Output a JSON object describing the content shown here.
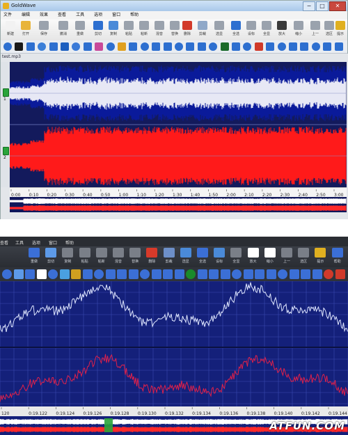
{
  "top": {
    "title": "GoldWave",
    "window_controls": [
      "−",
      "□",
      "✕"
    ],
    "menu": [
      "文件",
      "编辑",
      "效果",
      "查看",
      "工具",
      "选项",
      "窗口",
      "帮助"
    ],
    "toolbar": [
      {
        "label": "新建",
        "icon": "new-icon",
        "color": "#f2f2f2"
      },
      {
        "label": "打开",
        "icon": "open-icon",
        "color": "#e8b43a"
      },
      {
        "label": "保存",
        "icon": "save-icon",
        "color": "#9aa2ad"
      },
      {
        "label": "撤消",
        "icon": "undo-icon",
        "color": "#9aa2ad"
      },
      {
        "label": "重做",
        "icon": "redo-icon",
        "color": "#9aa2ad"
      },
      {
        "label": "剪切",
        "icon": "cut-icon",
        "color": "#2d6fd0"
      },
      {
        "label": "复制",
        "icon": "copy-icon",
        "color": "#4a8ad8"
      },
      {
        "label": "粘贴",
        "icon": "paste-icon",
        "color": "#9aa2ad"
      },
      {
        "label": "粘新",
        "icon": "paste-new-icon",
        "color": "#9aa2ad"
      },
      {
        "label": "混音",
        "icon": "mix-icon",
        "color": "#9aa2ad"
      },
      {
        "label": "替换",
        "icon": "replace-icon",
        "color": "#9aa2ad"
      },
      {
        "label": "删除",
        "icon": "delete-icon",
        "color": "#d23a2a"
      },
      {
        "label": "剪裁",
        "icon": "trim-icon",
        "color": "#8fa8c8"
      },
      {
        "label": "选显",
        "icon": "select-view-icon",
        "color": "#9aa2ad"
      },
      {
        "label": "全选",
        "icon": "select-all-icon",
        "color": "#2d6fd0"
      },
      {
        "label": "设标",
        "icon": "set-marker-icon",
        "color": "#9aa2ad"
      },
      {
        "label": "全显",
        "icon": "view-all-icon",
        "color": "#9aa2ad"
      },
      {
        "label": "放大",
        "icon": "zoom-in-icon",
        "color": "#3a3a3a"
      },
      {
        "label": "缩小",
        "icon": "zoom-out-icon",
        "color": "#9aa2ad"
      },
      {
        "label": "上一",
        "icon": "previous-icon",
        "color": "#9aa2ad"
      },
      {
        "label": "选区",
        "icon": "selection-icon",
        "color": "#9aa2ad"
      },
      {
        "label": "提示",
        "icon": "cue-icon",
        "color": "#e0b020"
      }
    ],
    "effects_toolbar_icons": [
      "volume-icon",
      "stop-icon",
      "spectrum-icon",
      "noise-icon",
      "filter-icon",
      "pitch-icon",
      "echo-icon",
      "reverb-icon",
      "compressor-icon",
      "equalizer-icon",
      "doppler-icon",
      "flanger-icon",
      "arrow-left-icon",
      "arrow-right-icon",
      "fade-icon",
      "balance-icon",
      "channel-icon",
      "stereo-icon",
      "mechanize-icon",
      "invert-icon",
      "offset-icon",
      "time-warp-icon",
      "playback-rate-icon",
      "marker-start-icon",
      "marker-end-icon",
      "fade-in-icon",
      "fade-out-icon",
      "amplify-icon",
      "normalize-icon",
      "silence-icon"
    ],
    "file_tab": "test.mp3",
    "ruler_labels": [
      "0:00",
      "0:10",
      "0:20",
      "0:30",
      "0:40",
      "0:50",
      "1:00",
      "1:10",
      "1:20",
      "1:30",
      "1:40",
      "1:50",
      "2:00",
      "2:10",
      "2:20",
      "2:30",
      "2:40",
      "2:50",
      "3:00"
    ],
    "channel_numbers": [
      "1",
      "2"
    ],
    "colors": {
      "top_channel": "#0a1a9a",
      "top_channel_selected": "#ffffff",
      "bottom_channel": "#ff1a1a",
      "background": "#131a5c"
    }
  },
  "bottom": {
    "menu": [
      "查看",
      "工具",
      "选项",
      "窗口",
      "帮助"
    ],
    "toolbar": [
      {
        "label": "重做",
        "color": "#3b6fd6"
      },
      {
        "label": "剪切",
        "color": "#5d9ae8"
      },
      {
        "label": "复制",
        "color": "#7a7f88"
      },
      {
        "label": "粘贴",
        "color": "#7a7f88"
      },
      {
        "label": "粘新",
        "color": "#7a7f88"
      },
      {
        "label": "混音",
        "color": "#7a7f88"
      },
      {
        "label": "替换",
        "color": "#7a7f88"
      },
      {
        "label": "删除",
        "color": "#d83a2a"
      },
      {
        "label": "剪裁",
        "color": "#6d8fc8"
      },
      {
        "label": "选显",
        "color": "#4a8ad8"
      },
      {
        "label": "全选",
        "color": "#3b6fd6"
      },
      {
        "label": "设标",
        "color": "#4a8ad8"
      },
      {
        "label": "全显",
        "color": "#7a7f88"
      },
      {
        "label": "放大",
        "color": "#ffffff"
      },
      {
        "label": "缩小",
        "color": "#ffffff"
      },
      {
        "label": "上一",
        "color": "#7a7f88"
      },
      {
        "label": "选区",
        "color": "#7a7f88"
      },
      {
        "label": "提示",
        "color": "#e0b020"
      },
      {
        "label": "帮助",
        "color": "#3b6fd6"
      }
    ],
    "ruler_labels": [
      "120",
      "0:19.122",
      "0:19.124",
      "0:19.126",
      "0:19.128",
      "0:19.130",
      "0:19.132",
      "0:19.134",
      "0:19.136",
      "0:19.138",
      "0:19.140",
      "0:19.142",
      "0:19.144"
    ],
    "watermark": "ATFUN.COM",
    "colors": {
      "top_channel": "#dfe6ff",
      "bottom_channel": "#e0204a",
      "background": "#14207a",
      "grid": "#3a4ab0"
    }
  }
}
